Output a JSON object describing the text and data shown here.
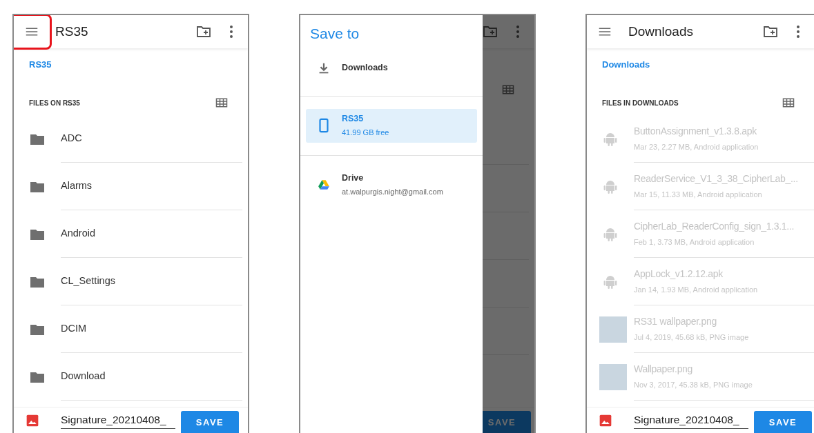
{
  "screens": [
    {
      "kind": "browser",
      "menu_highlighted": true,
      "title": "RS35",
      "breadcrumb": "RS35",
      "section": "FILES ON RS35",
      "items": [
        {
          "kind": "folder",
          "name": "ADC",
          "disabled": false
        },
        {
          "kind": "folder",
          "name": "Alarms",
          "disabled": false
        },
        {
          "kind": "folder",
          "name": "Android",
          "disabled": false
        },
        {
          "kind": "folder",
          "name": "CL_Settings",
          "disabled": false
        },
        {
          "kind": "folder",
          "name": "DCIM",
          "disabled": false
        },
        {
          "kind": "folder",
          "name": "Download",
          "disabled": false
        }
      ],
      "filename": "Signature_20210408_",
      "save": "SAVE"
    },
    {
      "kind": "drawer",
      "drawer_title": "Save to",
      "roots": [
        {
          "kind": "download",
          "name": "Downloads",
          "selected": false
        },
        {
          "kind": "device",
          "name": "RS35",
          "detail": "41.99 GB free",
          "selected": true
        },
        {
          "kind": "drive",
          "name": "Drive",
          "detail": "at.walpurgis.night@gmail.com",
          "selected": false
        }
      ],
      "save": "SAVE"
    },
    {
      "kind": "browser",
      "menu_highlighted": false,
      "title": "Downloads",
      "breadcrumb": "Downloads",
      "section": "FILES IN DOWNLOADS",
      "items": [
        {
          "kind": "apk",
          "name": "ButtonAssignment_v1.3.8.apk",
          "detail": "Mar 23, 2.27 MB, Android application",
          "disabled": true
        },
        {
          "kind": "apk",
          "name": "ReaderService_V1_3_38_CipherLab_...",
          "detail": "Mar 15, 11.33 MB, Android application",
          "disabled": true
        },
        {
          "kind": "apk",
          "name": "CipherLab_ReaderConfig_sign_1.3.1...",
          "detail": "Feb 1, 3.73 MB, Android application",
          "disabled": true
        },
        {
          "kind": "apk",
          "name": "AppLock_v1.2.12.apk",
          "detail": "Jan 14, 1.93 MB, Android application",
          "disabled": true
        },
        {
          "kind": "image",
          "name": "RS31 wallpaper.png",
          "detail": "Jul 4, 2019, 45.68 kB, PNG image",
          "disabled": true
        },
        {
          "kind": "image",
          "name": "Wallpaper.png",
          "detail": "Nov 3, 2017, 45.38 kB, PNG image",
          "disabled": true
        }
      ],
      "filename": "Signature_20210408_",
      "save": "SAVE"
    }
  ]
}
